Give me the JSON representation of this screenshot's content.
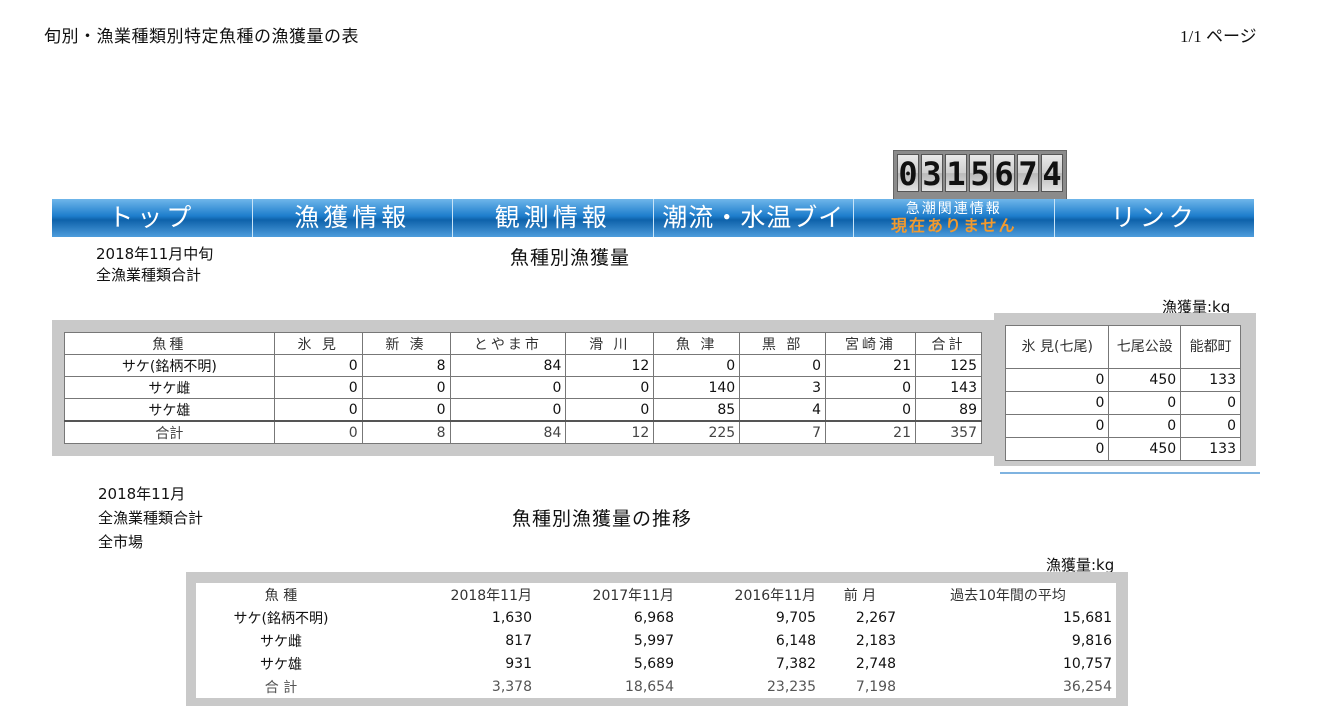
{
  "header": {
    "doc_title": "旬別・漁業種類別特定魚種の漁獲量の表",
    "page_indicator": "1/1 ページ"
  },
  "counter": {
    "digits": [
      "0",
      "3",
      "1",
      "5",
      "6",
      "7",
      "4"
    ]
  },
  "nav": {
    "items": [
      "トップ",
      "漁獲情報",
      "観測情報",
      "潮流・水温ブイ",
      "リンク"
    ],
    "alert_title": "急潮関連情報",
    "alert_status": "現在ありません"
  },
  "section1": {
    "period": "2018年11月中旬",
    "scope": "全漁業種類合計",
    "title": "魚種別漁獲量",
    "unit": "漁獲量:kg",
    "headers": [
      "魚種",
      "氷 見",
      "新 湊",
      "とやま市",
      "滑 川",
      "魚 津",
      "黒 部",
      "宮崎浦",
      "合計"
    ],
    "rows": [
      {
        "name": "サケ(銘柄不明)",
        "values": [
          "0",
          "8",
          "84",
          "12",
          "0",
          "0",
          "21",
          "125"
        ]
      },
      {
        "name": "サケ雌",
        "values": [
          "0",
          "0",
          "0",
          "0",
          "140",
          "3",
          "0",
          "143"
        ]
      },
      {
        "name": "サケ雄",
        "values": [
          "0",
          "0",
          "0",
          "0",
          "85",
          "4",
          "0",
          "89"
        ]
      },
      {
        "name": "合計",
        "values": [
          "0",
          "8",
          "84",
          "12",
          "225",
          "7",
          "21",
          "357"
        ]
      }
    ],
    "ishikawa_headers": [
      "氷 見(七尾)",
      "七尾公設",
      "能都町"
    ],
    "ishikawa_rows": [
      [
        "0",
        "450",
        "133"
      ],
      [
        "0",
        "0",
        "0"
      ],
      [
        "0",
        "0",
        "0"
      ],
      [
        "0",
        "450",
        "133"
      ]
    ]
  },
  "section2": {
    "period": "2018年11月",
    "scope": "全漁業種類合計",
    "market": "全市場",
    "title": "魚種別漁獲量の推移",
    "unit": "漁獲量:kg",
    "headers": [
      "魚 種",
      "2018年11月",
      "2017年11月",
      "2016年11月",
      "前 月",
      "過去10年間の平均"
    ],
    "rows": [
      {
        "name": "サケ(銘柄不明)",
        "values": [
          "1,630",
          "6,968",
          "9,705",
          "2,267",
          "15,681"
        ]
      },
      {
        "name": "サケ雌",
        "values": [
          "817",
          "5,997",
          "6,148",
          "2,183",
          "9,816"
        ]
      },
      {
        "name": "サケ雄",
        "values": [
          "931",
          "5,689",
          "7,382",
          "2,748",
          "10,757"
        ]
      },
      {
        "name": "合 計",
        "values": [
          "3,378",
          "18,654",
          "23,235",
          "7,198",
          "36,254"
        ]
      }
    ]
  }
}
